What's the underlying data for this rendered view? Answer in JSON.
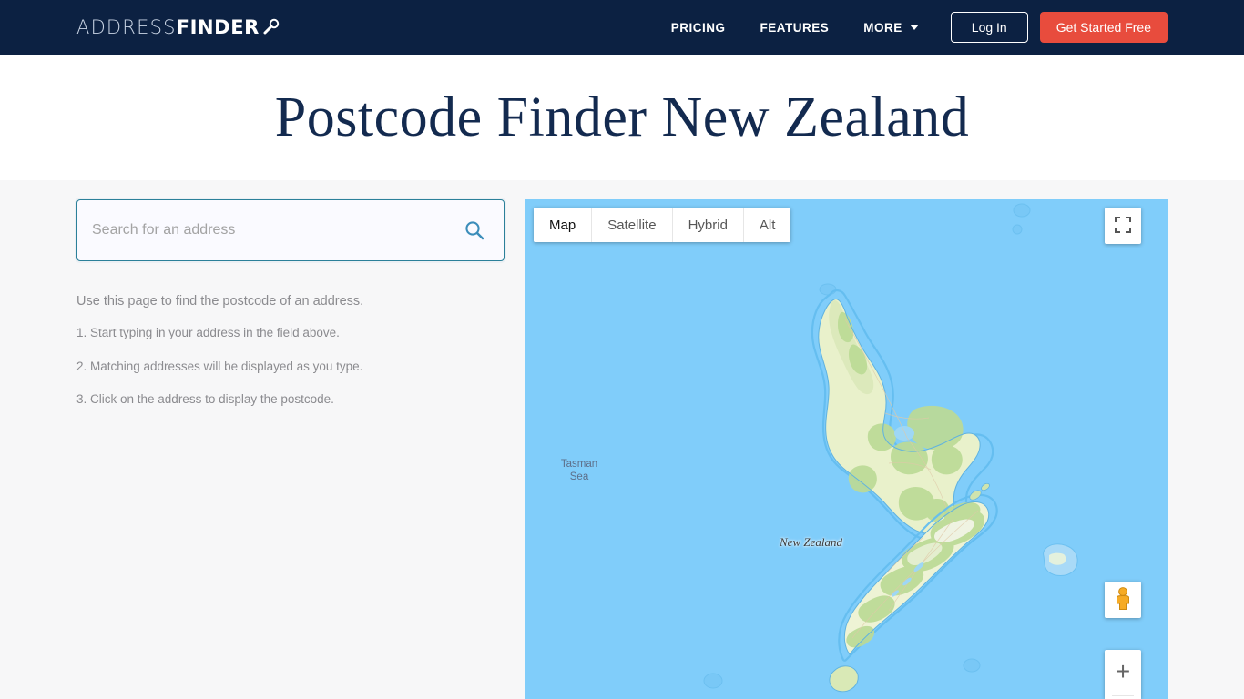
{
  "header": {
    "logo": {
      "part1": "ADDRESS",
      "part2": "FINDER",
      "icon": "magnifier-key-icon"
    },
    "nav": [
      {
        "label": "PRICING",
        "id": "pricing"
      },
      {
        "label": "FEATURES",
        "id": "features"
      },
      {
        "label": "MORE",
        "id": "more",
        "has_dropdown": true
      }
    ],
    "login_label": "Log In",
    "cta_label": "Get Started Free",
    "bg_color": "#0c2142",
    "cta_color": "#e84c3d"
  },
  "hero": {
    "title": "Postcode Finder New Zealand",
    "title_color": "#132a4f"
  },
  "search": {
    "value": "",
    "placeholder": "Search for an address",
    "icon": "search-icon",
    "border_color": "#2b8099"
  },
  "instructions": {
    "intro": "Use this page to find the postcode of an address.",
    "steps": [
      "1. Start typing in your address in the field above.",
      "2. Matching addresses will be displayed as you type.",
      "3. Click on the address to display the postcode."
    ]
  },
  "map": {
    "types": [
      {
        "label": "Map",
        "active": true
      },
      {
        "label": "Satellite",
        "active": false
      },
      {
        "label": "Hybrid",
        "active": false
      },
      {
        "label": "Alt",
        "active": false
      }
    ],
    "controls": {
      "fullscreen": "fullscreen-icon",
      "pegman": "street-view-pegman-icon",
      "zoom_in": "+"
    },
    "labels": [
      {
        "text": "Tasman",
        "text2": "Sea",
        "id": "tasman-sea"
      },
      {
        "text": "New Zealand",
        "id": "new-zealand"
      }
    ],
    "ocean_color": "#80cdfa",
    "land_color": "#e8f0c8",
    "forest_color": "#bfdf9a"
  }
}
